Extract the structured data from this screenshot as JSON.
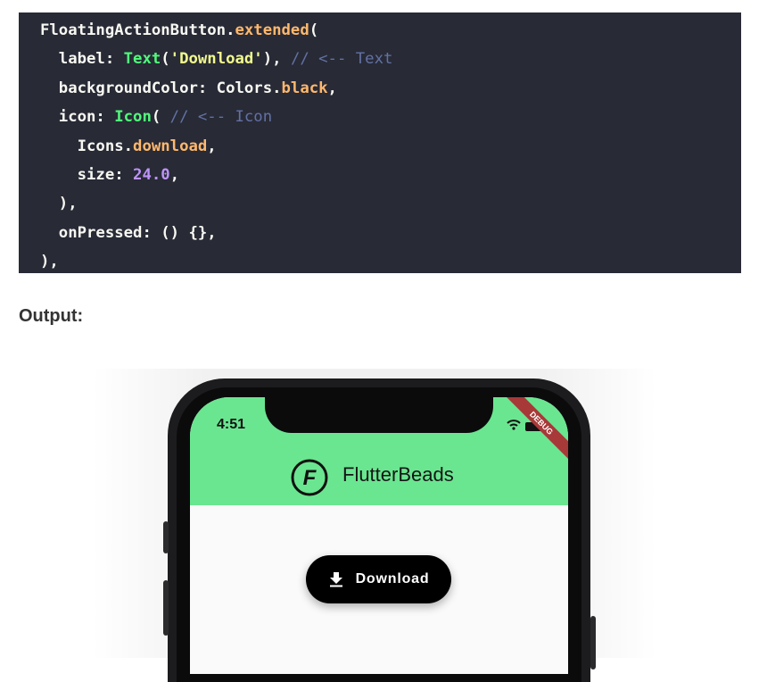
{
  "code": {
    "lines": [
      [
        "FloatingActionButton.",
        "extended",
        "("
      ],
      [
        "  label: ",
        "Text",
        "(",
        "'Download'",
        "), ",
        "// <-- Text"
      ],
      [
        "  backgroundColor: Colors.",
        "black",
        ","
      ],
      [
        "  icon: ",
        "Icon",
        "( ",
        "// <-- Icon"
      ],
      [
        "    Icons.",
        "download",
        ","
      ],
      [
        "    size: ",
        "24.0",
        ","
      ],
      [
        "  ),"
      ],
      [
        "  onPressed: () {},"
      ],
      [
        "),"
      ]
    ]
  },
  "output_label": "Output:",
  "phone": {
    "time": "4:51",
    "debug_banner": "DEBUG",
    "brand": "FlutterBeads",
    "logo_letter": "F",
    "fab_label": "Download",
    "appbar_color": "#6ae690",
    "fab_color": "#000000",
    "icons": [
      "wifi-icon",
      "battery-icon",
      "download-icon",
      "flutterbeads-logo-icon"
    ]
  }
}
